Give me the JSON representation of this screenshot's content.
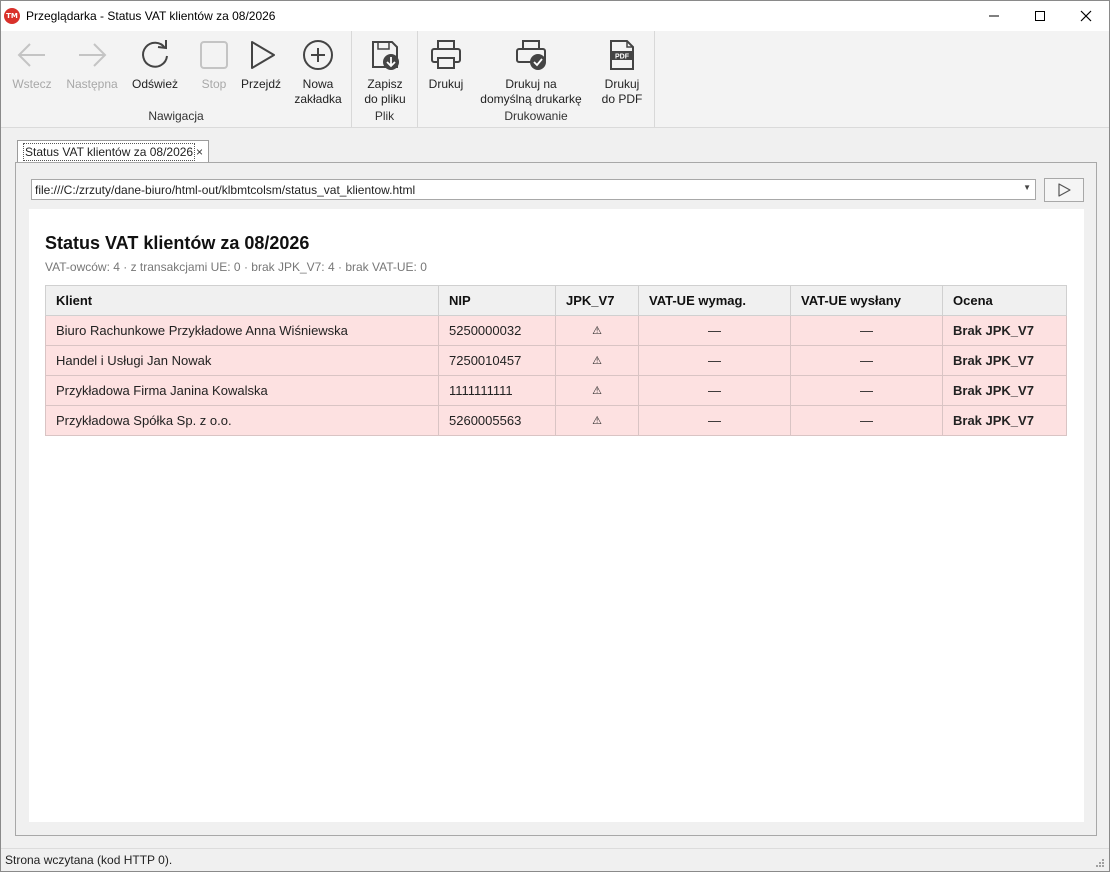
{
  "window": {
    "app_icon_text": "TM",
    "title": "Przeglądarka - Status VAT klientów za 08/2026"
  },
  "ribbon": {
    "groups": [
      {
        "label": "Nawigacja",
        "buttons": [
          {
            "label": "Wstecz",
            "icon": "back-arrow-icon",
            "enabled": false
          },
          {
            "label": "Następna",
            "icon": "forward-arrow-icon",
            "enabled": false
          },
          {
            "label": "Odśwież",
            "icon": "refresh-icon",
            "enabled": true
          },
          {
            "label": "Stop",
            "icon": "stop-icon",
            "enabled": false
          },
          {
            "label": "Przejdź",
            "icon": "play-icon",
            "enabled": true
          },
          {
            "label": "Nowa\nzakładka",
            "icon": "plus-circle-icon",
            "enabled": true
          }
        ]
      },
      {
        "label": "Plik",
        "buttons": [
          {
            "label": "Zapisz\ndo pliku",
            "icon": "save-disk-icon",
            "enabled": true
          }
        ]
      },
      {
        "label": "Drukowanie",
        "buttons": [
          {
            "label": "Drukuj",
            "icon": "printer-icon",
            "enabled": true
          },
          {
            "label": "Drukuj na\ndomyślną drukarkę",
            "icon": "printer-check-icon",
            "enabled": true
          },
          {
            "label": "Drukuj\ndo PDF",
            "icon": "pdf-file-icon",
            "enabled": true
          }
        ]
      }
    ]
  },
  "tab": {
    "label": "Status VAT klientów za 08/2026",
    "close": "×"
  },
  "address": {
    "url": "file:///C:/zrzuty/dane-biuro/html-out/klbmtcolsm/status_vat_klientow.html"
  },
  "page": {
    "title": "Status VAT klientów za 08/2026",
    "summary": "VAT-owców: 4 · z transakcjami UE: 0 · brak JPK_V7: 4 · brak VAT-UE: 0",
    "columns": [
      "Klient",
      "NIP",
      "JPK_V7",
      "VAT-UE wymag.",
      "VAT-UE wysłany",
      "Ocena"
    ],
    "rows": [
      {
        "klient": "Biuro Rachunkowe Przykładowe Anna Wiśniewska",
        "nip": "5250000032",
        "jpk": "⚠",
        "vatue_req": "—",
        "vatue_sent": "—",
        "ocena": "Brak JPK_V7"
      },
      {
        "klient": "Handel i Usługi Jan Nowak",
        "nip": "7250010457",
        "jpk": "⚠",
        "vatue_req": "—",
        "vatue_sent": "—",
        "ocena": "Brak JPK_V7"
      },
      {
        "klient": "Przykładowa Firma Janina Kowalska",
        "nip": "1111111111",
        "jpk": "⚠",
        "vatue_req": "—",
        "vatue_sent": "—",
        "ocena": "Brak JPK_V7"
      },
      {
        "klient": "Przykładowa Spółka Sp. z o.o.",
        "nip": "5260005563",
        "jpk": "⚠",
        "vatue_req": "—",
        "vatue_sent": "—",
        "ocena": "Brak JPK_V7"
      }
    ]
  },
  "statusbar": {
    "text": "Strona wczytana (kod HTTP 0)."
  },
  "colors": {
    "row_warning_bg": "#fde1e1",
    "app_icon_red": "#d9312b",
    "disabled_text": "#a8a8a8"
  }
}
